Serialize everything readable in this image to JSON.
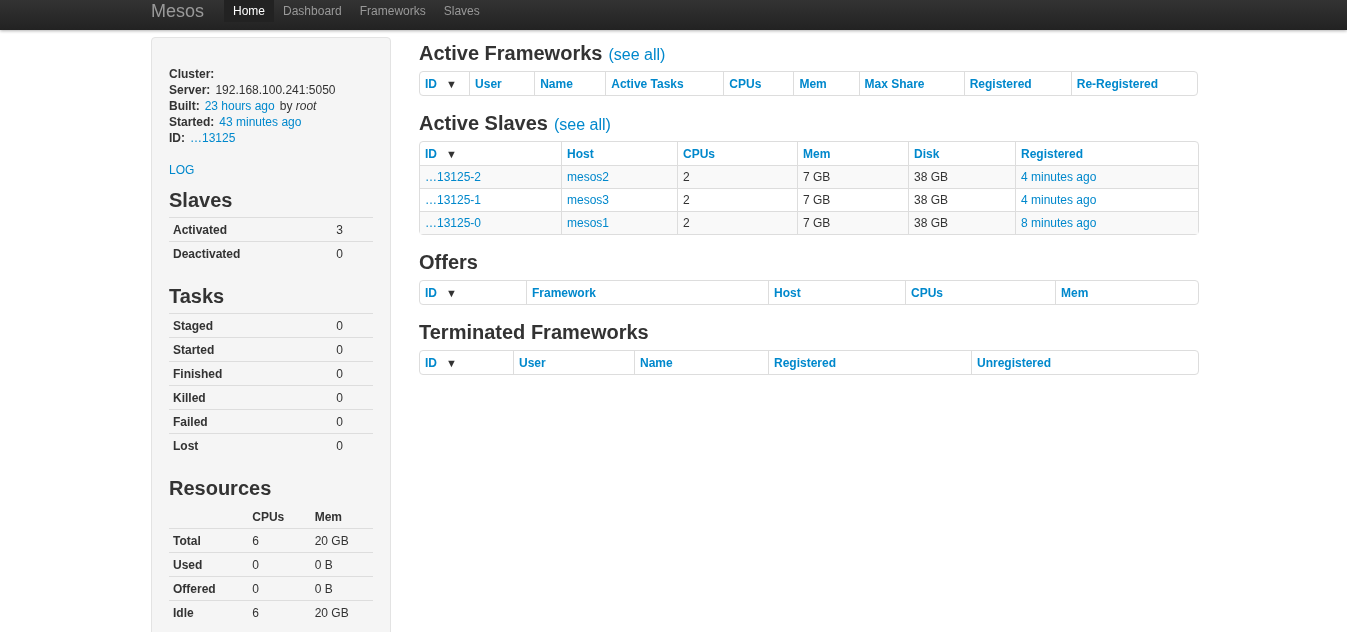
{
  "navbar": {
    "brand": "Mesos",
    "items": [
      {
        "label": "Home",
        "selected": true
      },
      {
        "label": "Dashboard",
        "selected": false
      },
      {
        "label": "Frameworks",
        "selected": false
      },
      {
        "label": "Slaves",
        "selected": false
      }
    ]
  },
  "sidebar": {
    "info": [
      {
        "label": "Cluster:"
      },
      {
        "label": "Server:",
        "value": "192.168.100.241:5050",
        "link": false
      },
      {
        "label": "Built:",
        "value": "23 hours ago",
        "link": true,
        "suffix": "by *root*"
      },
      {
        "label": "Started:",
        "value": "43 minutes ago",
        "link": true
      },
      {
        "label": "ID:",
        "value": "…13125",
        "link": true
      }
    ],
    "log": "LOG",
    "slaves": {
      "title": "Slaves",
      "rows": [
        {
          "label": "Activated",
          "value": "3"
        },
        {
          "label": "Deactivated",
          "value": "0"
        }
      ]
    },
    "tasks": {
      "title": "Tasks",
      "rows": [
        {
          "label": "Staged",
          "value": "0"
        },
        {
          "label": "Started",
          "value": "0"
        },
        {
          "label": "Finished",
          "value": "0"
        },
        {
          "label": "Killed",
          "value": "0"
        },
        {
          "label": "Failed",
          "value": "0"
        },
        {
          "label": "Lost",
          "value": "0"
        }
      ]
    },
    "resources": {
      "title": "Resources",
      "columns": [
        "CPUs",
        "Mem"
      ],
      "rows": [
        {
          "label": "Total",
          "cpus": "6",
          "mem": "20 GB"
        },
        {
          "label": "Used",
          "cpus": "0",
          "mem": "0 B"
        },
        {
          "label": "Offered",
          "cpus": "0",
          "mem": "0 B"
        },
        {
          "label": "Idle",
          "cpus": "6",
          "mem": "20 GB"
        }
      ]
    }
  },
  "sections": [
    {
      "title": "Active Frameworks",
      "see_all": "(see all)",
      "sort_arrow": "▼",
      "columns": [
        "ID",
        "User",
        "Name",
        "Active Tasks",
        "CPUs",
        "Mem",
        "Max Share",
        "Registered",
        "Re-Registered"
      ]
    },
    {
      "title": "Active Slaves",
      "see_all": "(see all)",
      "sort_arrow": "▼",
      "columns": [
        "ID",
        "Host",
        "CPUs",
        "Mem",
        "Disk",
        "Registered"
      ],
      "rows": [
        {
          "cells": [
            "…13125-2",
            "mesos2",
            "2",
            "7 GB",
            "38 GB",
            "4 minutes ago"
          ]
        },
        {
          "cells": [
            "…13125-1",
            "mesos3",
            "2",
            "7 GB",
            "38 GB",
            "4 minutes ago"
          ]
        },
        {
          "cells": [
            "…13125-0",
            "mesos1",
            "2",
            "7 GB",
            "38 GB",
            "8 minutes ago"
          ]
        }
      ]
    },
    {
      "title": "Offers",
      "sort_arrow": "▼",
      "columns": [
        "ID",
        "Framework",
        "Host",
        "CPUs",
        "Mem"
      ]
    },
    {
      "title": "Terminated Frameworks",
      "sort_arrow": "▼",
      "columns": [
        "ID",
        "User",
        "Name",
        "Registered",
        "Unregistered"
      ]
    }
  ]
}
